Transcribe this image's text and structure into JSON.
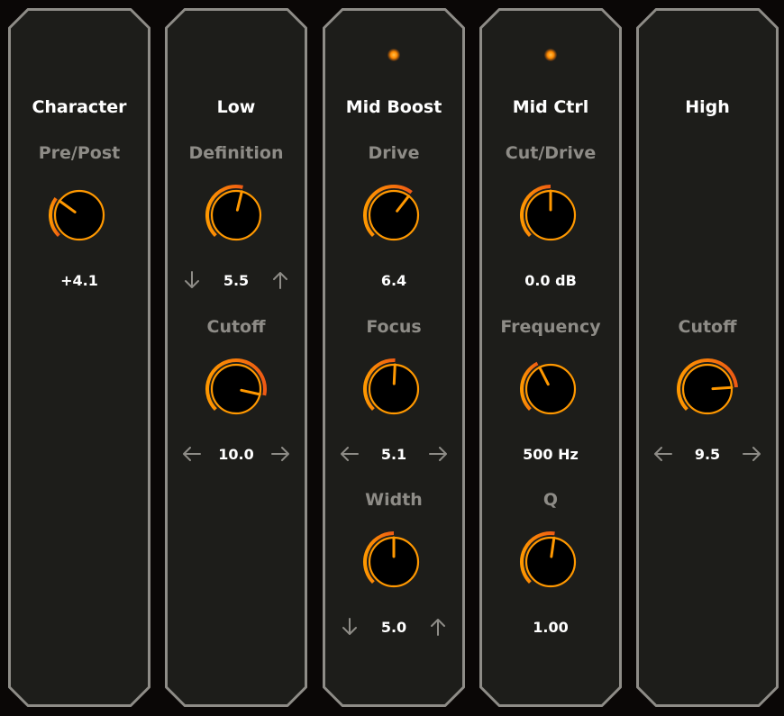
{
  "colors": {
    "accent": "#ff9800",
    "accent_hot": "#ef5a14",
    "frame": "#8e8c87",
    "panel_bg": "#1d1d1a",
    "label": "#8e8c87"
  },
  "panels": [
    {
      "title": "Character",
      "led": false,
      "params": [
        {
          "label": "Pre/Post",
          "value": "+4.1",
          "level": 0.3,
          "arrows": "none"
        }
      ]
    },
    {
      "title": "Low",
      "led": false,
      "params": [
        {
          "label": "Definition",
          "value": "5.5",
          "level": 0.55,
          "arrows": "vertical"
        },
        {
          "label": "Cutoff",
          "value": "10.0",
          "level": 0.88,
          "arrows": "horizontal"
        }
      ]
    },
    {
      "title": "Mid Boost",
      "led": true,
      "params": [
        {
          "label": "Drive",
          "value": "6.4",
          "level": 0.64,
          "arrows": "none"
        },
        {
          "label": "Focus",
          "value": "5.1",
          "level": 0.51,
          "arrows": "horizontal"
        },
        {
          "label": "Width",
          "value": "5.0",
          "level": 0.5,
          "arrows": "vertical"
        }
      ]
    },
    {
      "title": "Mid Ctrl",
      "led": true,
      "params": [
        {
          "label": "Cut/Drive",
          "value": "0.0 dB",
          "level": 0.5,
          "arrows": "none"
        },
        {
          "label": "Frequency",
          "value": "500 Hz",
          "level": 0.4,
          "arrows": "none"
        },
        {
          "label": "Q",
          "value": "1.00",
          "level": 0.53,
          "arrows": "none"
        }
      ]
    },
    {
      "title": "High",
      "led": false,
      "params": [
        {
          "label": "Cutoff",
          "value": "9.5",
          "level": 0.82,
          "arrows": "horizontal",
          "row": 1
        }
      ]
    }
  ],
  "icons": {
    "up": "arrow-up-icon",
    "down": "arrow-down-icon",
    "left": "arrow-left-icon",
    "right": "arrow-right-icon",
    "led": "led-indicator-icon"
  }
}
